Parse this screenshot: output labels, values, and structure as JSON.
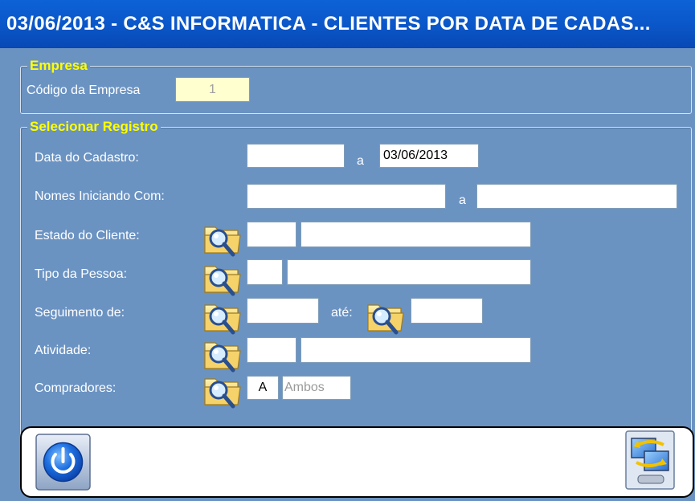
{
  "window": {
    "title": "03/06/2013  -  C&S INFORMATICA  -  CLIENTES POR DATA DE CADAS..."
  },
  "empresa": {
    "legend": "Empresa",
    "codigo_label": "Código da Empresa",
    "codigo_value": "1"
  },
  "registro": {
    "legend": "Selecionar Registro",
    "data_cadastro_label": "Data do Cadastro:",
    "data_from": "",
    "data_sep": "a",
    "data_to": "03/06/2013",
    "nomes_label": "Nomes Iniciando Com:",
    "nomes_from": "",
    "nomes_sep": "a",
    "nomes_to": "",
    "estado_label": "Estado do Cliente:",
    "estado_code": "",
    "estado_desc": "",
    "tipo_label": "Tipo da Pessoa:",
    "tipo_code": "",
    "tipo_desc": "",
    "seguimento_label": "Seguimento de:",
    "seguimento_from": "",
    "seguimento_ate_label": "até:",
    "seguimento_to": "",
    "atividade_label": "Atividade:",
    "atividade_code": "",
    "atividade_desc": "",
    "compradores_label": "Compradores:",
    "compradores_code": "A",
    "compradores_desc": "Ambos"
  },
  "icons": {
    "search": "folder-search-icon",
    "power": "power-icon",
    "transfer": "computer-transfer-icon"
  }
}
